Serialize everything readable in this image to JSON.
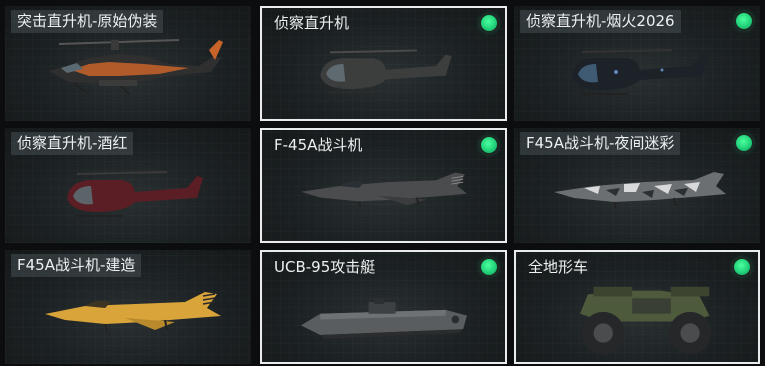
{
  "vehicles": [
    {
      "name": "突击直升机-原始伪装",
      "equipped": false,
      "selected": false,
      "icon": "attack-helicopter-icon"
    },
    {
      "name": "侦察直升机",
      "equipped": true,
      "selected": true,
      "icon": "scout-helicopter-icon"
    },
    {
      "name": "侦察直升机-烟火2026",
      "equipped": true,
      "selected": false,
      "icon": "scout-helicopter-icon"
    },
    {
      "name": "侦察直升机-酒红",
      "equipped": false,
      "selected": false,
      "icon": "scout-helicopter-icon"
    },
    {
      "name": "F-45A战斗机",
      "equipped": true,
      "selected": true,
      "icon": "fighter-jet-icon"
    },
    {
      "name": "F45A战斗机-夜间迷彩",
      "equipped": true,
      "selected": false,
      "icon": "fighter-jet-icon"
    },
    {
      "name": "F45A战斗机-建造",
      "equipped": false,
      "selected": false,
      "icon": "fighter-jet-icon"
    },
    {
      "name": "UCB-95攻击艇",
      "equipped": true,
      "selected": true,
      "icon": "attack-boat-icon"
    },
    {
      "name": "全地形车",
      "equipped": true,
      "selected": true,
      "icon": "atv-icon"
    }
  ],
  "colors": {
    "equip_green": "#22d27a",
    "selected_border": "#e9ecee",
    "tile_bg": "#1b2022",
    "page_bg": "#0b0d0e"
  }
}
